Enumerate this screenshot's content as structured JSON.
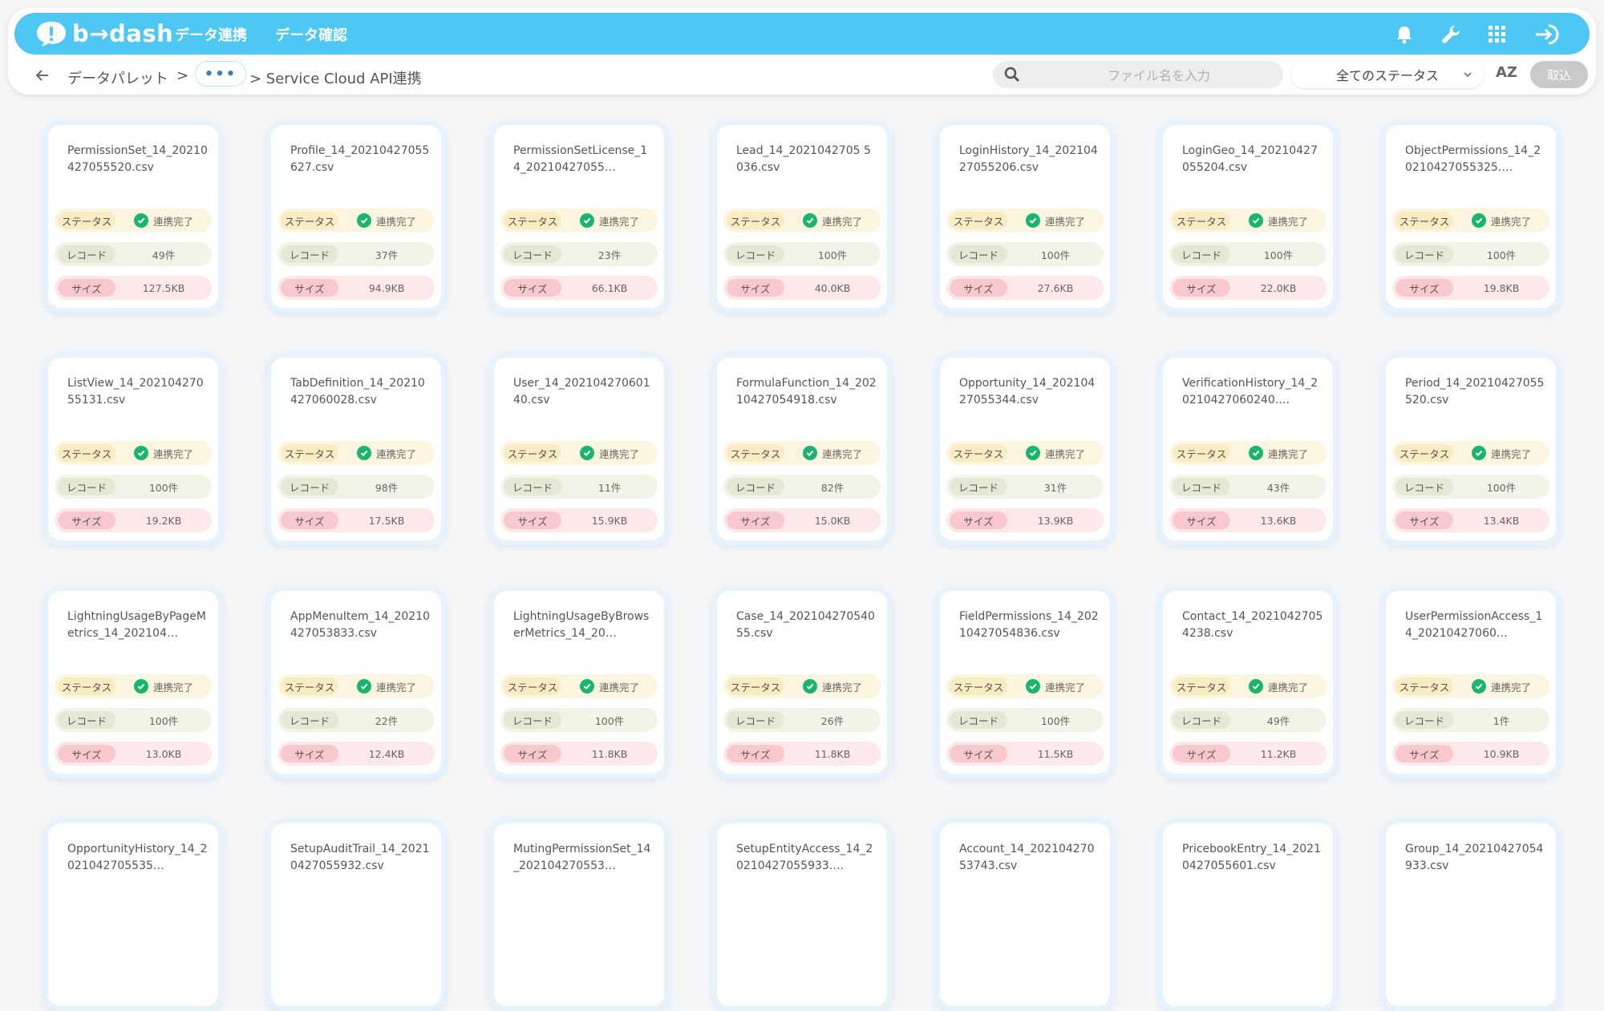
{
  "header": {
    "brand": "b→dash",
    "nav": [
      "データ連携",
      "データ確認"
    ]
  },
  "breadcrumb": {
    "root": "データパレット",
    "sep": ">",
    "ellipsis": "•••",
    "current": "> Service Cloud API連携"
  },
  "toolbar": {
    "search_placeholder": "ファイル名を入力",
    "status_filter": "全てのステータス",
    "sort_label": "AZ",
    "import_label": "取込"
  },
  "labels": {
    "status": "ステータス",
    "record": "レコード",
    "size": "サイズ"
  },
  "colors": {
    "header_blue": "#4ec7f5",
    "status_ok_green": "#19b56f"
  },
  "cards": [
    {
      "name": "PermissionSet_14_20210427055520.csv",
      "status": "連携完了",
      "records": "49件",
      "size": "127.5KB"
    },
    {
      "name": "Profile_14_20210427055627.csv",
      "status": "連携完了",
      "records": "37件",
      "size": "94.9KB"
    },
    {
      "name": "PermissionSetLicense_14_20210427055…",
      "status": "連携完了",
      "records": "23件",
      "size": "66.1KB"
    },
    {
      "name": "Lead_14_2021042705 5036.csv",
      "status": "連携完了",
      "records": "100件",
      "size": "40.0KB"
    },
    {
      "name": "LoginHistory_14_20210427055206.csv",
      "status": "連携完了",
      "records": "100件",
      "size": "27.6KB"
    },
    {
      "name": "LoginGeo_14_20210427055204.csv",
      "status": "連携完了",
      "records": "100件",
      "size": "22.0KB"
    },
    {
      "name": "ObjectPermissions_14_20210427055325.…",
      "status": "連携完了",
      "records": "100件",
      "size": "19.8KB"
    },
    {
      "name": "ListView_14_20210427055131.csv",
      "status": "連携完了",
      "records": "100件",
      "size": "19.2KB"
    },
    {
      "name": "TabDefinition_14_20210427060028.csv",
      "status": "連携完了",
      "records": "98件",
      "size": "17.5KB"
    },
    {
      "name": "User_14_20210427060140.csv",
      "status": "連携完了",
      "records": "11件",
      "size": "15.9KB"
    },
    {
      "name": "FormulaFunction_14_20210427054918.csv",
      "status": "連携完了",
      "records": "82件",
      "size": "15.0KB"
    },
    {
      "name": "Opportunity_14_20210427055344.csv",
      "status": "連携完了",
      "records": "31件",
      "size": "13.9KB"
    },
    {
      "name": "VerificationHistory_14_20210427060240.…",
      "status": "連携完了",
      "records": "43件",
      "size": "13.6KB"
    },
    {
      "name": "Period_14_20210427055520.csv",
      "status": "連携完了",
      "records": "100件",
      "size": "13.4KB"
    },
    {
      "name": "LightningUsageByPageMetrics_14_202104…",
      "status": "連携完了",
      "records": "100件",
      "size": "13.0KB"
    },
    {
      "name": "AppMenuItem_14_20210427053833.csv",
      "status": "連携完了",
      "records": "22件",
      "size": "12.4KB"
    },
    {
      "name": "LightningUsageByBrowserMetrics_14_20…",
      "status": "連携完了",
      "records": "100件",
      "size": "11.8KB"
    },
    {
      "name": "Case_14_20210427054055.csv",
      "status": "連携完了",
      "records": "26件",
      "size": "11.8KB"
    },
    {
      "name": "FieldPermissions_14_20210427054836.csv",
      "status": "連携完了",
      "records": "100件",
      "size": "11.5KB"
    },
    {
      "name": "Contact_14_20210427054238.csv",
      "status": "連携完了",
      "records": "49件",
      "size": "11.2KB"
    },
    {
      "name": "UserPermissionAccess_14_20210427060…",
      "status": "連携完了",
      "records": "1件",
      "size": "10.9KB"
    },
    {
      "name": "OpportunityHistory_14_2021042705535…",
      "status": "",
      "records": "",
      "size": ""
    },
    {
      "name": "SetupAuditTrail_14_20210427055932.csv",
      "status": "",
      "records": "",
      "size": ""
    },
    {
      "name": "MutingPermissionSet_14_202104270553…",
      "status": "",
      "records": "",
      "size": ""
    },
    {
      "name": "SetupEntityAccess_14_20210427055933.…",
      "status": "",
      "records": "",
      "size": ""
    },
    {
      "name": "Account_14_20210427053743.csv",
      "status": "",
      "records": "",
      "size": ""
    },
    {
      "name": "PricebookEntry_14_20210427055601.csv",
      "status": "",
      "records": "",
      "size": ""
    },
    {
      "name": "Group_14_20210427054933.csv",
      "status": "",
      "records": "",
      "size": ""
    }
  ]
}
